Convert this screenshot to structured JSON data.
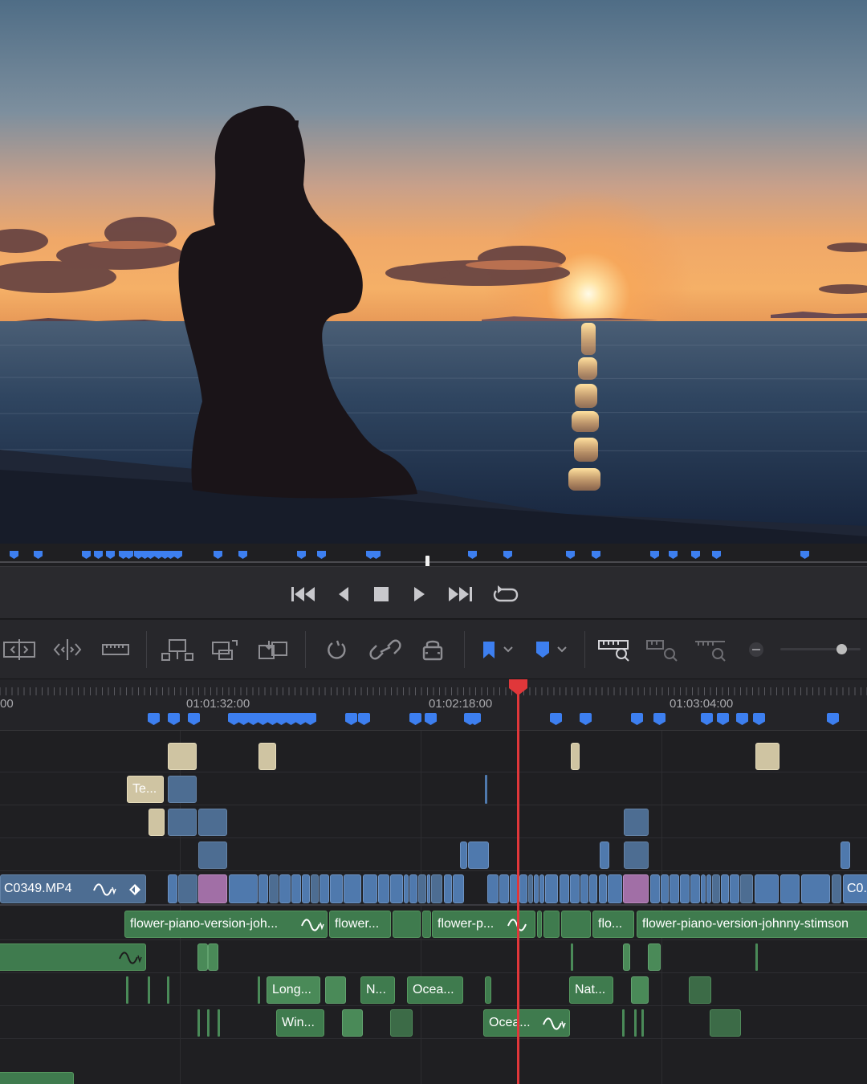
{
  "viewer": {
    "scene": "sunset-silhouette"
  },
  "transport": {
    "icons": [
      "skip-to-start-icon",
      "step-back-icon",
      "stop-icon",
      "play-icon",
      "skip-to-end-icon",
      "loop-icon"
    ]
  },
  "toolbar": {
    "icons": [
      "trim-mode-icon",
      "dynamic-trim-icon",
      "blade-icon",
      "insert-clip-icon",
      "overwrite-clip-icon",
      "replace-clip-icon",
      "snapping-icon",
      "linked-selection-icon",
      "position-lock-icon",
      "flag-icon",
      "marker-icon",
      "zoom-full-icon",
      "zoom-detail-icon",
      "zoom-custom-icon",
      "zoom-out-icon"
    ],
    "zoom_level": 0.73
  },
  "ruler": {
    "timecode_left": "00",
    "timecode_1": "01:01:32:00",
    "timecode_2": "01:02:18:00",
    "timecode_3": "01:03:04:00"
  },
  "clips": {
    "te": "Te...",
    "video_main": "C0349.MP4",
    "video_end": "C0...",
    "a1_1": "flower-piano-version-joh...",
    "a1_2": "flower...",
    "a1_3": "flower-p...",
    "a1_4": "flo...",
    "a1_5": "flower-piano-version-johnny-stimson",
    "a3_1": "Long...",
    "a3_2": "N...",
    "a3_3": "Ocea...",
    "a3_4": "Nat...",
    "a4_1": "Win...",
    "a4_2": "Ocea..."
  },
  "colors": {
    "playhead": "#e0373a",
    "marker": "#3d7ff0",
    "video_clip": "#4f79ad",
    "audio_clip": "#3f7b4e"
  }
}
